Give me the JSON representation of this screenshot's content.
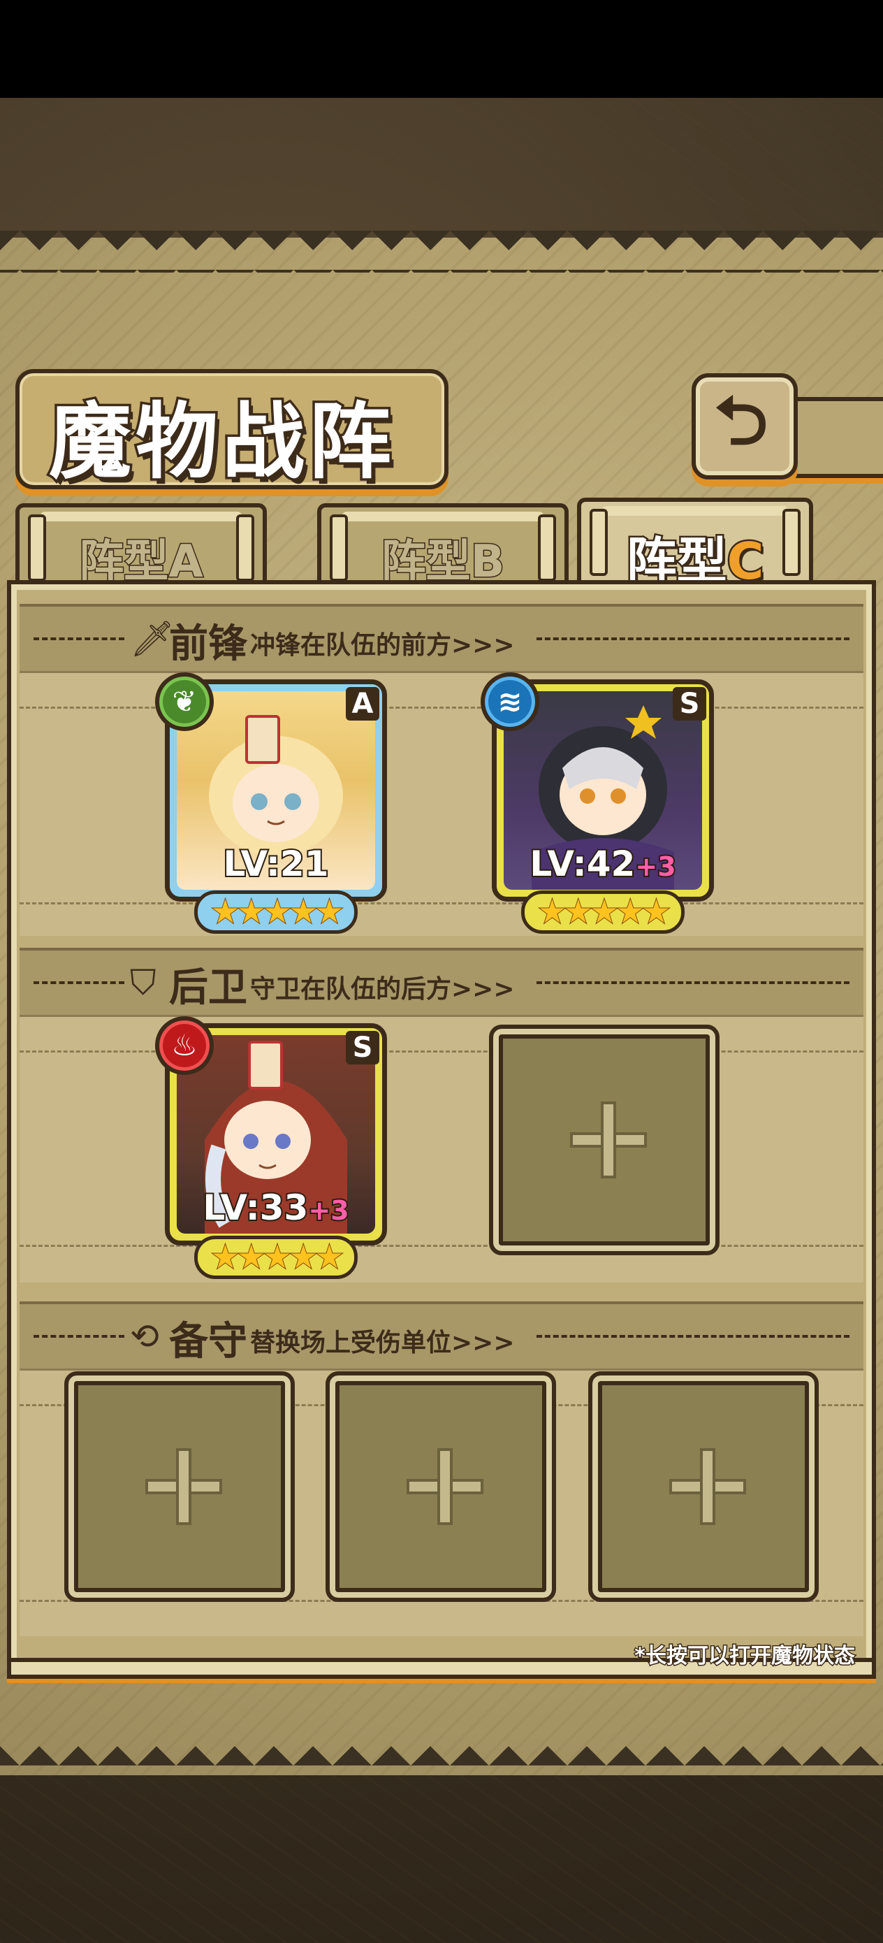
{
  "title": "魔物战阵",
  "back_button": {
    "icon": "back-arrow-icon",
    "glyph": "⮌"
  },
  "tabs": [
    {
      "prefix": "阵型",
      "letter": "A",
      "active": false
    },
    {
      "prefix": "阵型",
      "letter": "B",
      "active": false
    },
    {
      "prefix": "阵型",
      "letter": "C",
      "active": true
    }
  ],
  "sections": {
    "vanguard": {
      "title": "前锋",
      "subtitle": "冲锋在队伍的前方>>>",
      "icon": "sword-icon"
    },
    "rearguard": {
      "title": "后卫",
      "subtitle": "守卫在队伍的后方>>>",
      "icon": "shield-icon"
    },
    "reserve": {
      "title": "备守",
      "subtitle": "替换场上受伤单位>>>",
      "icon": "swap-icon"
    }
  },
  "vanguard_units": [
    {
      "rank": "A",
      "level": "LV:21",
      "bonus": "",
      "element": "grass",
      "stars": "★★★★★"
    },
    {
      "rank": "S",
      "level": "LV:42",
      "bonus": "+3",
      "element": "water",
      "stars": "★★★★★"
    }
  ],
  "rearguard_units": [
    {
      "rank": "S",
      "level": "LV:33",
      "bonus": "+3",
      "element": "fire",
      "stars": "★★★★★"
    }
  ],
  "hint": "*长按可以打开魔物状态",
  "colors": {
    "frame": "#3d2b1a",
    "accent": "#e09226",
    "rank_a": "#8fd0ee",
    "rank_s": "#e9e04a",
    "level_bonus": "#ff5fa8"
  }
}
